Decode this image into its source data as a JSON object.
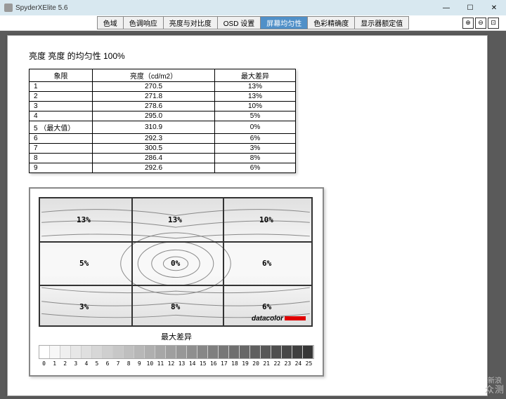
{
  "app": {
    "title": "SpyderXElite 5.6"
  },
  "tabs": {
    "items": [
      "色域",
      "色调响应",
      "亮度与对比度",
      "OSD 设置",
      "屏幕均匀性",
      "色彩精确度",
      "显示器额定值"
    ],
    "active_index": 4
  },
  "report": {
    "title": "亮度 亮度 的均匀性 100%",
    "headers": {
      "zone": "象限",
      "luminance": "亮度（cd/m2）",
      "diff": "最大差异"
    },
    "rows": [
      {
        "zone": "1",
        "lum": "270.5",
        "diff": "13%"
      },
      {
        "zone": "2",
        "lum": "271.8",
        "diff": "13%"
      },
      {
        "zone": "3",
        "lum": "278.6",
        "diff": "10%"
      },
      {
        "zone": "4",
        "lum": "295.0",
        "diff": "5%"
      },
      {
        "zone": "5 （最大值）",
        "lum": "310.9",
        "diff": "0%"
      },
      {
        "zone": "6",
        "lum": "292.3",
        "diff": "6%"
      },
      {
        "zone": "7",
        "lum": "300.5",
        "diff": "3%"
      },
      {
        "zone": "8",
        "lum": "286.4",
        "diff": "8%"
      },
      {
        "zone": "9",
        "lum": "292.6",
        "diff": "6%"
      }
    ]
  },
  "contour": {
    "cells": [
      "13%",
      "13%",
      "10%",
      "5%",
      "0%",
      "6%",
      "3%",
      "8%",
      "6%"
    ],
    "legend_title": "最大差异",
    "brand": "datacolor",
    "scale_max": 25
  },
  "watermark": {
    "line1": "新浪",
    "line2": "众测"
  }
}
